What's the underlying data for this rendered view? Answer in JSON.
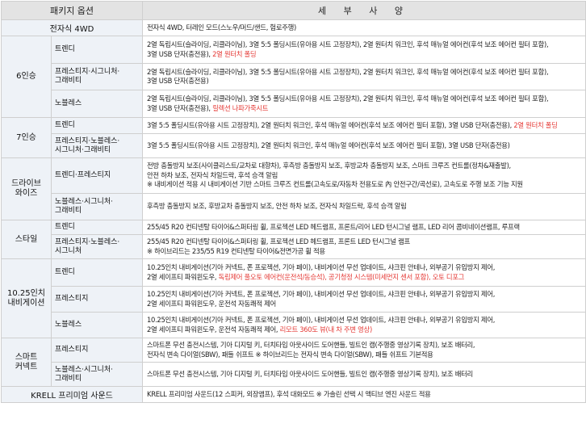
{
  "header": {
    "col1": "패키지 옵션",
    "col2": "세 부 사 양"
  },
  "rows": {
    "awd": {
      "label": "전자식 4WD",
      "desc": "전자식 4WD, 터레인 모드(스노우/머드/샌드, 험로주행)"
    },
    "six": {
      "label": "6인승",
      "trendy": {
        "label": "트렌디",
        "line1": "2열 독립시트(슬라이딩, 리클라이닝), 3열 5:5 폴딩시트(유아용 시트 고정장치), 2열 원터치 워크인, 후석 매뉴얼 에어컨(후석 보조 에어컨 필터 포함),",
        "line2": "3열 USB 단자(충전용), ",
        "line2_red": "2열 원터치 폴딩"
      },
      "prestige": {
        "label1": "프레스티지·시그니처·",
        "label2": "그래비티",
        "line1": "2열 독립시트(슬라이딩, 리클라이닝), 3열 5:5 폴딩시트(유아용 시트 고정장치), 2열 원터치 워크인, 후석 매뉴얼 에어컨(후석 보조 에어컨 필터 포함),",
        "line2": "3열 USB 단자(충전용)"
      },
      "noblesse": {
        "label": "노블레스",
        "line1": "2열 독립시트(슬라이딩, 리클라이닝), 3열 5:5 폴딩시트(유아용 시트 고정장치), 2열 원터치 워크인, 후석 매뉴얼 에어컨(후석 보조 에어컨 필터 포함),",
        "line2": "3열 USB 단자(충전용), ",
        "line2_red": "릴렉션 나파가죽시트"
      }
    },
    "seven": {
      "label": "7인승",
      "trendy": {
        "label": "트렌디",
        "line1": "3열 5:5 폴딩시트(유아용 시트 고정장치), 2열 원터치 워크인, 후석 매뉴얼 에어컨(후석 보조 에어컨 필터 포함), 3열 USB 단자(충전용), ",
        "line1_red": "2열 원터치 폴딩"
      },
      "prestige": {
        "label1": "프레스티지·노블레스·",
        "label2": "시그니처·그래비티",
        "line1": "3열 5:5 폴딩시트(유아용 시트 고정장치), 2열 원터치 워크인, 후석 매뉴얼 에어컨(후석 보조 에어컨 필터 포함), 3열 USB 단자(충전용)"
      }
    },
    "drive": {
      "label1": "드라이브",
      "label2": "와이즈",
      "trendy": {
        "label": "트렌디·프레스티지",
        "line1": "전방 충돌방지 보조(사이클리스트/교차로 대향차), 후측방 충돌방지 보조, 후방교차 충돌방지 보조, 스마트 크루즈 컨트롤(정차&재출발),",
        "line2": "안전 하차 보조, 전자식 차일드락, 후석 승객 알림",
        "line3": "※ 내비게이션 적용 시 내비게이션 기반 스마트 크루즈 컨트롤(고속도로/자동차 전용도로 內 안전구간/곡선로), 고속도로 주행 보조 기능 지원"
      },
      "noblesse": {
        "label1": "노블레스·시그니처·",
        "label2": "그래비티",
        "line1": "후측방 충돌방지 보조, 후방교차 충돌방지 보조, 안전 하차 보조, 전자식 차일드락, 후석 승객 알림"
      }
    },
    "style": {
      "label": "스타일",
      "trendy": {
        "label": "트렌디",
        "line1": "255/45 R20 컨티넨탈 타이어&스퍼터링 휠, 프로젝션 LED 헤드램프, 프론트/리어 LED 턴시그널 램프, LED 리어 콤비네이션램프, 루프랙"
      },
      "prestige": {
        "label1": "프레스티지·노블레스·",
        "label2": "시그니처",
        "line1": "255/45 R20 컨티넨탈 타이어&스퍼터링 휠, 프로젝션 LED 헤드램프, 프론트 LED 턴시그널 램프",
        "line2": "※ 하이브리드는 235/55 R19 컨티넨탈 타이어&전면가공 휠 적용"
      }
    },
    "navi": {
      "label1": "10.25인치",
      "label2": "내비게이션",
      "trendy": {
        "label": "트렌디",
        "line1": "10.25인치 내비게이션(기아 커넥트, 폰 프로젝션, 기아 페이), 내비게이션 무선 업데이트, 샤크핀 안테나, 외부공기 유입방지 제어,",
        "line2": "2열 세이프티 파워윈도우, ",
        "line2_red": "독립제어 풀오토 에어컨(운전석/동승석), 공기청정 시스템(미세먼지 센서 포함), 오토 디포그"
      },
      "prestige": {
        "label": "프레스티지",
        "line1": "10.25인치 내비게이션(기아 커넥트, 폰 프로젝션, 기아 페이), 내비게이션 무선 업데이트, 샤크핀 안테나, 외부공기 유입방지 제어,",
        "line2": "2열 세이프티 파워윈도우, 운전석 자동쾌적 제어"
      },
      "noblesse": {
        "label": "노블레스",
        "line1": "10.25인치 내비게이션(기아 커넥트, 폰 프로젝션, 기아 페이), 내비게이션 무선 업데이트, 샤크핀 안테나, 외부공기 유입방지 제어,",
        "line2": "2열 세이프티 파워윈도우, 운전석 자동쾌적 제어, ",
        "line2_red": "리모트 360도 뷰(내 차 주변 영상)"
      }
    },
    "smart": {
      "label1": "스마트",
      "label2": "커넥트",
      "prestige": {
        "label": "프레스티지",
        "line1": "스마트폰 무선 충전시스템, 기아 디지털 키, 터치타입 아웃사이드 도어핸들, 빌트인 캠(주행중 영상기록 장치), 보조 배터리,",
        "line2": "전자식 변속 다이얼(SBW), 패들 쉬프트 ※ 하이브리드는 전자식 변속 다이얼(SBW), 패들 쉬프트 기본적용"
      },
      "noblesse": {
        "label1": "노블레스·시그니처·",
        "label2": "그래비티",
        "line1": "스마트폰 무선 충전시스템, 기아 디지털 키, 터치타입 아웃사이드 도어핸들, 빌트인 캠(주행중 영상기록 장치), 보조 배터리"
      }
    },
    "krell": {
      "label": "KRELL 프리미엄 사운드",
      "desc": "KRELL 프리미엄 사운드(12 스피커, 외장앰프), 후석 대화모드 ※ 가솔린 선택 시 액티브 엔진 사운드 적용"
    }
  }
}
